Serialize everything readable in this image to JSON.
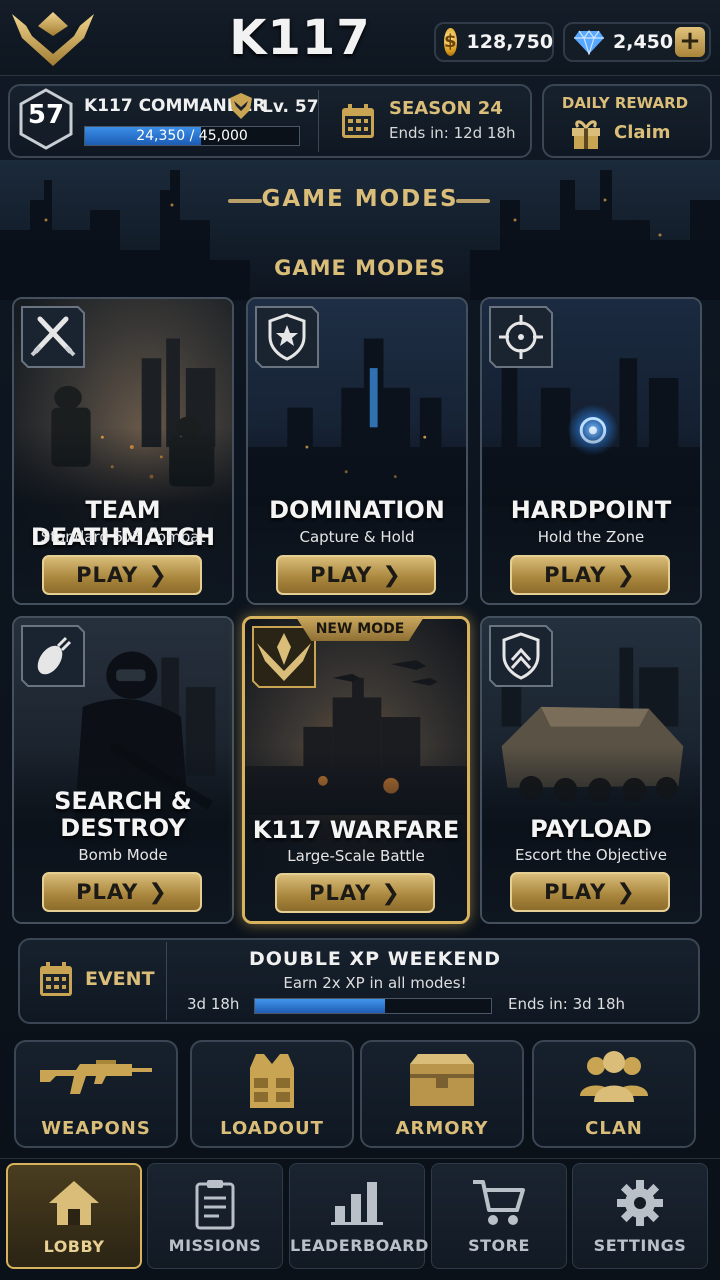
{
  "app": {
    "title": "K117"
  },
  "currency": {
    "coins": "128,750",
    "gems": "2,450",
    "add_label": "+"
  },
  "profile": {
    "level": "57",
    "name": "K117 COMMANDER",
    "level_label": "Lv. 57",
    "xp": "24,350 / 45,000",
    "xp_progress": 0.541
  },
  "season": {
    "title": "SEASON 24",
    "ends": "Ends in: 12d 18h"
  },
  "daily_reward": {
    "title": "DAILY REWARD",
    "claim": "Claim"
  },
  "section": {
    "header": "GAME MODES",
    "subheader": "GAME MODES"
  },
  "modes": [
    {
      "title": "TEAM DEATHMATCH",
      "subtitle": "Standard 5v5 Combat",
      "play": "PLAY",
      "icon": "crossed-swords-icon"
    },
    {
      "title": "DOMINATION",
      "subtitle": "Capture & Hold",
      "play": "PLAY",
      "icon": "star-shield-icon"
    },
    {
      "title": "HARDPOINT",
      "subtitle": "Hold the Zone",
      "play": "PLAY",
      "icon": "crosshair-icon"
    },
    {
      "title_line1": "SEARCH &",
      "title_line2": "DESTROY",
      "subtitle": "Bomb Mode",
      "play": "PLAY",
      "icon": "bomb-icon"
    },
    {
      "title": "K117 WARFARE",
      "subtitle": "Large-Scale Battle",
      "play": "PLAY",
      "badge": "NEW MODE",
      "icon": "winged-emblem-icon"
    },
    {
      "title": "PAYLOAD",
      "subtitle": "Escort the Objective",
      "play": "PLAY",
      "icon": "chevron-shield-icon"
    }
  ],
  "event": {
    "label": "EVENT",
    "title": "DOUBLE XP WEEKEND",
    "description": "Earn 2x XP in all modes!",
    "time_left": "3d 18h",
    "ends": "Ends in: 3d 18h",
    "progress": 0.55
  },
  "quick_links": [
    {
      "label": "WEAPONS",
      "icon": "rifle-icon"
    },
    {
      "label": "LOADOUT",
      "icon": "vest-icon"
    },
    {
      "label": "ARMORY",
      "icon": "crate-icon"
    },
    {
      "label": "CLAN",
      "icon": "group-icon"
    }
  ],
  "nav": [
    {
      "label": "LOBBY",
      "icon": "home-icon",
      "active": true
    },
    {
      "label": "MISSIONS",
      "icon": "clipboard-icon"
    },
    {
      "label": "LEADERBOARD",
      "icon": "bar-chart-icon"
    },
    {
      "label": "STORE",
      "icon": "cart-icon"
    },
    {
      "label": "SETTINGS",
      "icon": "gear-icon"
    }
  ],
  "colors": {
    "accent_gold": "#d9bd78",
    "xp_blue": "#2f7fd8",
    "background": "#0c131d"
  }
}
